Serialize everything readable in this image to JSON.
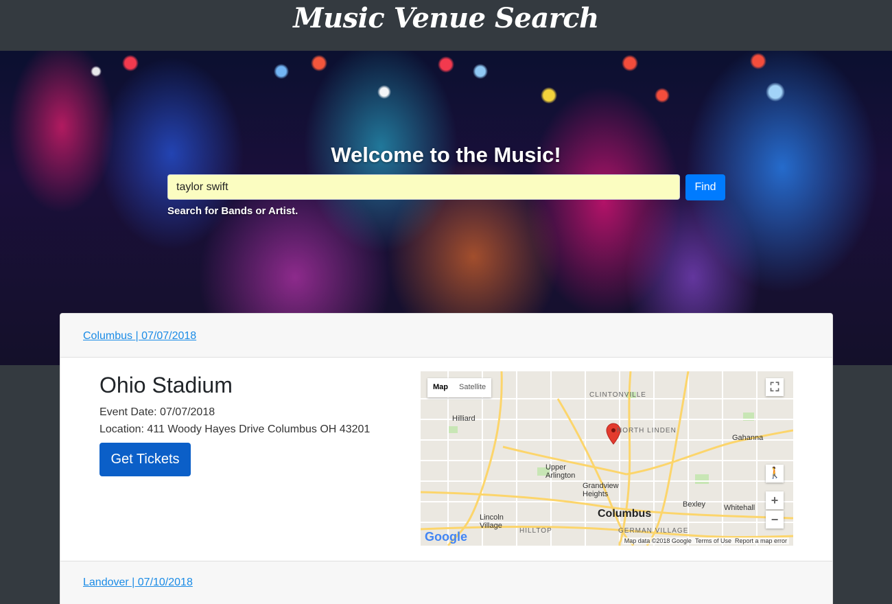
{
  "header": {
    "title": "Music Venue Search"
  },
  "hero": {
    "heading": "Welcome to the Music!",
    "search_value": "taylor swift",
    "find_label": "Find",
    "hint": "Search for Bands or Artist."
  },
  "results": [
    {
      "link": "Columbus | 07/07/2018",
      "venue": "Ohio Stadium",
      "date": "Event Date: 07/07/2018",
      "location": "Location: 411 Woody Hayes Drive Columbus OH 43201",
      "tickets_label": "Get Tickets"
    },
    {
      "link": "Landover | 07/10/2018"
    }
  ],
  "map": {
    "type_map": "Map",
    "type_satellite": "Satellite",
    "city": "Columbus",
    "labels": [
      "Hilliard",
      "CLINTONVILLE",
      "NORTH LINDEN",
      "Gahanna",
      "Upper Arlington",
      "Grandview Heights",
      "Bexley",
      "Whitehall",
      "Lincoln Village",
      "HILLTOP",
      "GERMAN VILLAGE"
    ],
    "attribution": "Map data ©2018 Google",
    "terms": "Terms of Use",
    "report": "Report a map error",
    "logo": "Google"
  },
  "colors": {
    "primary": "#007bff",
    "header_bg": "#343a40",
    "input_bg": "#fbfdc1",
    "link": "#1a8be6"
  }
}
